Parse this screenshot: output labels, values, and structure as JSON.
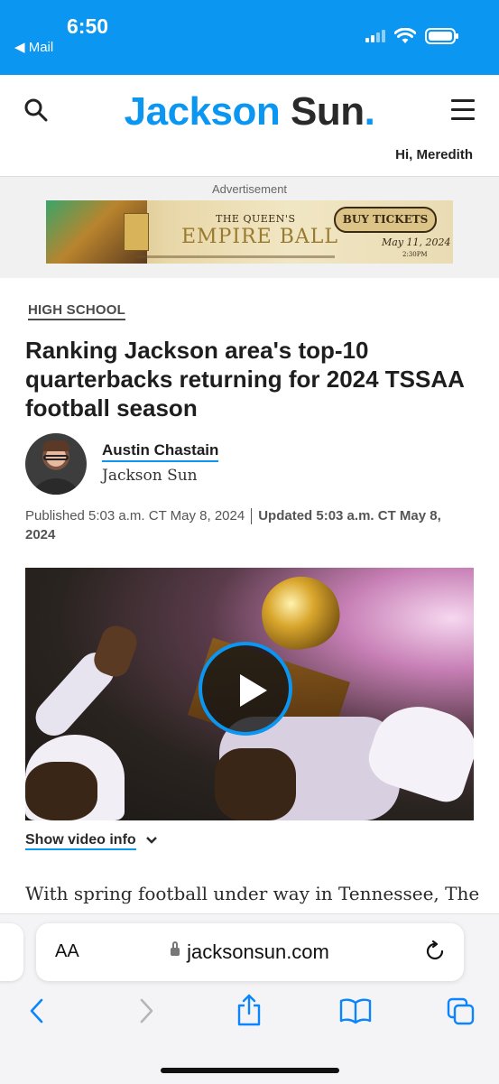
{
  "status_bar": {
    "time": "6:50",
    "back_app": "◀ Mail",
    "icons": [
      "signal-icon",
      "wifi-icon",
      "battery-icon"
    ]
  },
  "header": {
    "logo_part1": "Jackson",
    "logo_part2": "Sun",
    "logo_dot": ".",
    "greeting": "Hi, Meredith",
    "brand_color": "#0b96f1"
  },
  "ad": {
    "label": "Advertisement",
    "title_small": "THE QUEEN'S",
    "title_large": "EMPIRE BALL",
    "button": "BUY TICKETS",
    "date": "May 11, 2024",
    "time": "2:30PM"
  },
  "article": {
    "section": "HIGH SCHOOL",
    "headline": "Ranking Jackson area's top-10 quarterbacks returning for 2024 TSSAA football season",
    "author": "Austin Chastain",
    "outlet": "Jackson Sun",
    "published": "Published 5:03 a.m. CT May 8, 2024",
    "updated": "Updated 5:03 a.m. CT May 8, 2024",
    "video_info": "Show video info",
    "body_start": "With spring football under way in Tennessee, The"
  },
  "browser": {
    "text_size": "AA",
    "url": "jacksonsun.com",
    "toolbar": [
      "back-icon",
      "forward-icon",
      "share-icon",
      "bookmarks-icon",
      "tabs-icon"
    ]
  }
}
